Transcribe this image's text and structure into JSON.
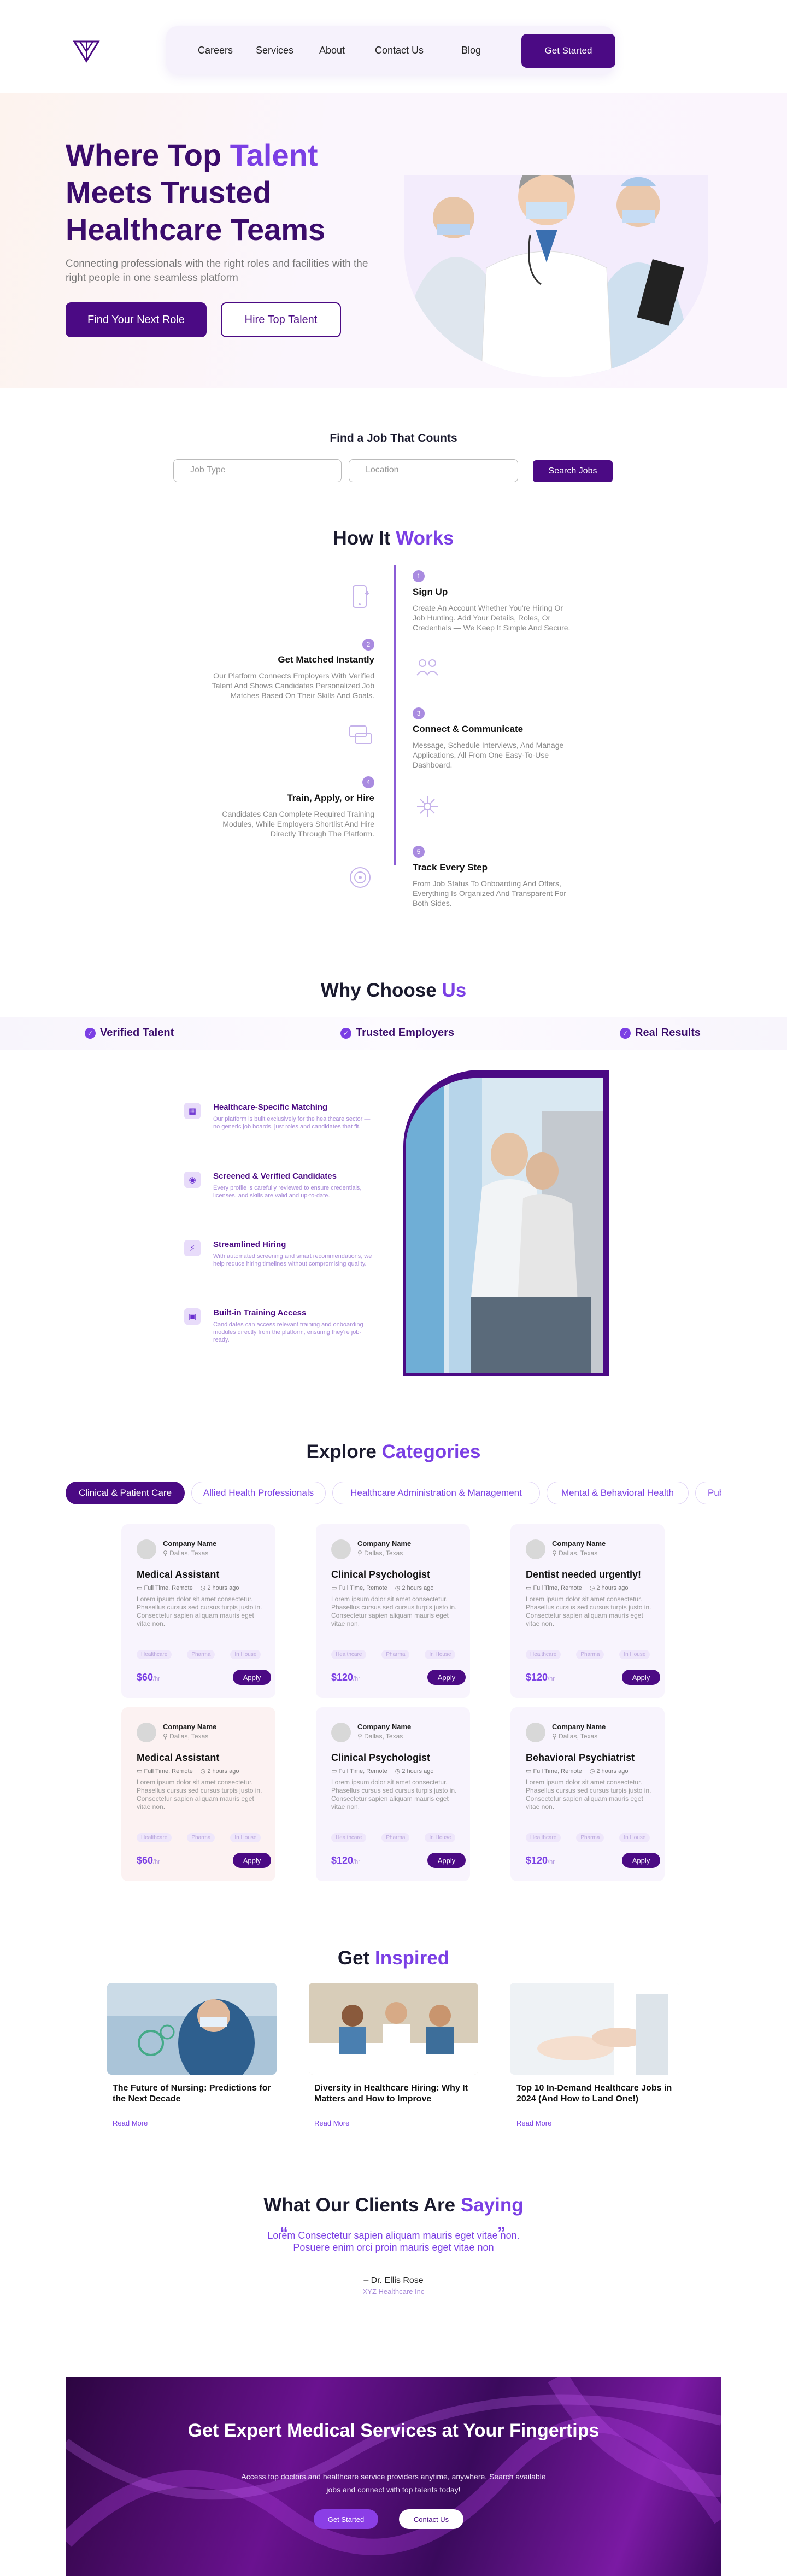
{
  "nav": {
    "links": [
      "Careers",
      "Services",
      "About",
      "Contact Us",
      "Blog"
    ],
    "cta": "Get Started"
  },
  "hero": {
    "title_a": "Where Top ",
    "title_accent": "Talent",
    "title_b": "Meets Trusted Healthcare Teams",
    "subtitle": "Connecting professionals with the right roles and facilities with the right people in one seamless platform",
    "btn_primary": "Find Your Next Role",
    "btn_secondary": "Hire Top Talent"
  },
  "find_job": {
    "title": "Find a Job That Counts",
    "job_type_placeholder": "Job Type",
    "location_placeholder": "Location",
    "search": "Search Jobs"
  },
  "how": {
    "title": "How It ",
    "title_accent": "Works",
    "steps": [
      {
        "num": "1",
        "title": "Sign Up",
        "text": "Create An Account Whether You're Hiring Or Job Hunting. Add Your Details, Roles, Or Credentials — We Keep It Simple And Secure."
      },
      {
        "num": "2",
        "title": "Get Matched Instantly",
        "text": "Our Platform Connects Employers With Verified Talent And Shows Candidates Personalized Job Matches Based On Their Skills And Goals."
      },
      {
        "num": "3",
        "title": "Connect & Communicate",
        "text": "Message, Schedule Interviews, And Manage Applications, All From One Easy-To-Use Dashboard."
      },
      {
        "num": "4",
        "title": "Train, Apply, or Hire",
        "text": "Candidates Can Complete Required Training Modules, While Employers Shortlist And Hire Directly Through The Platform."
      },
      {
        "num": "5",
        "title": "Track Every Step",
        "text": "From Job Status To Onboarding And Offers, Everything Is Organized And Transparent For Both Sides."
      }
    ]
  },
  "why": {
    "title": "Why Choose ",
    "title_accent": "Us",
    "badges": [
      "Verified Talent",
      "Trusted Employers",
      "Real Results"
    ],
    "features": [
      {
        "title": "Healthcare-Specific Matching",
        "text": "Our platform is built exclusively for the healthcare sector — no generic job boards, just roles and candidates that fit."
      },
      {
        "title": "Screened & Verified Candidates",
        "text": "Every profile is carefully reviewed to ensure credentials, licenses, and skills are valid and up-to-date."
      },
      {
        "title": "Streamlined Hiring",
        "text": "With automated screening and smart recommendations, we help reduce hiring timelines without compromising quality."
      },
      {
        "title": "Built-in Training Access",
        "text": "Candidates can access relevant training and onboarding modules directly from the platform, ensuring they're job-ready."
      }
    ]
  },
  "categories": {
    "title": "Explore ",
    "title_accent": "Categories",
    "tabs": [
      "Clinical & Patient Care",
      "Allied Health Professionals",
      "Healthcare Administration & Management",
      "Mental & Behavioral Health",
      "Public Health"
    ],
    "jobs": [
      {
        "company": "Company Name",
        "location": "Dallas, Texas",
        "title": "Medical Assistant",
        "type": "Full Time, Remote",
        "posted": "2 hours ago",
        "desc": "Lorem ipsum dolor sit amet consectetur. Phasellus cursus sed cursus turpis justo in. Consectetur sapien aliquam mauris eget vitae non.",
        "tags": [
          "Healthcare",
          "Pharma",
          "In House"
        ],
        "price": "$60",
        "per": "/hr",
        "apply": "Apply"
      },
      {
        "company": "Company Name",
        "location": "Dallas, Texas",
        "title": "Clinical Psychologist",
        "type": "Full Time, Remote",
        "posted": "2 hours ago",
        "desc": "Lorem ipsum dolor sit amet consectetur. Phasellus cursus sed cursus turpis justo in. Consectetur sapien aliquam mauris eget vitae non.",
        "tags": [
          "Healthcare",
          "Pharma",
          "In House"
        ],
        "price": "$120",
        "per": "/hr",
        "apply": "Apply"
      },
      {
        "company": "Company Name",
        "location": "Dallas, Texas",
        "title": "Dentist needed urgently!",
        "type": "Full Time, Remote",
        "posted": "2 hours ago",
        "desc": "Lorem ipsum dolor sit amet consectetur. Phasellus cursus sed cursus turpis justo in. Consectetur sapien aliquam mauris eget vitae non.",
        "tags": [
          "Healthcare",
          "Pharma",
          "In House"
        ],
        "price": "$120",
        "per": "/hr",
        "apply": "Apply"
      },
      {
        "company": "Company Name",
        "location": "Dallas, Texas",
        "title": "Medical Assistant",
        "type": "Full Time, Remote",
        "posted": "2 hours ago",
        "desc": "Lorem ipsum dolor sit amet consectetur. Phasellus cursus sed cursus turpis justo in. Consectetur sapien aliquam mauris eget vitae non.",
        "tags": [
          "Healthcare",
          "Pharma",
          "In House"
        ],
        "price": "$60",
        "per": "/hr",
        "apply": "Apply"
      },
      {
        "company": "Company Name",
        "location": "Dallas, Texas",
        "title": "Clinical Psychologist",
        "type": "Full Time, Remote",
        "posted": "2 hours ago",
        "desc": "Lorem ipsum dolor sit amet consectetur. Phasellus cursus sed cursus turpis justo in. Consectetur sapien aliquam mauris eget vitae non.",
        "tags": [
          "Healthcare",
          "Pharma",
          "In House"
        ],
        "price": "$120",
        "per": "/hr",
        "apply": "Apply"
      },
      {
        "company": "Company Name",
        "location": "Dallas, Texas",
        "title": "Behavioral Psychiatrist",
        "type": "Full Time, Remote",
        "posted": "2 hours ago",
        "desc": "Lorem ipsum dolor sit amet consectetur. Phasellus cursus sed cursus turpis justo in. Consectetur sapien aliquam mauris eget vitae non.",
        "tags": [
          "Healthcare",
          "Pharma",
          "In House"
        ],
        "price": "$120",
        "per": "/hr",
        "apply": "Apply"
      }
    ]
  },
  "blog": {
    "title": "Get ",
    "title_accent": "Inspired",
    "posts": [
      {
        "title": "The Future of Nursing: Predictions for the Next Decade",
        "more": "Read More"
      },
      {
        "title": "Diversity in Healthcare Hiring: Why It Matters and How to Improve",
        "more": "Read More"
      },
      {
        "title": "Top 10 In-Demand Healthcare Jobs in 2024 (And How to Land One!)",
        "more": "Read More"
      }
    ]
  },
  "testimonials": {
    "title": "What Our Clients Are ",
    "title_accent": "Saying",
    "quote": "Lorem Consectetur sapien aliquam mauris eget vitae non. Posuere enim orci proin mauris eget vitae non",
    "author": "– Dr. Ellis Rose",
    "org": "XYZ Healthcare Inc"
  },
  "cta": {
    "title": "Get Expert Medical Services at Your Fingertips",
    "subtitle": "Access top doctors and healthcare service providers anytime, anywhere. Search available jobs and connect with top talents today!",
    "btn_primary": "Get Started",
    "btn_secondary": "Contact Us"
  },
  "colors": {
    "primary": "#4b0a84",
    "accent": "#7b3fe4"
  }
}
